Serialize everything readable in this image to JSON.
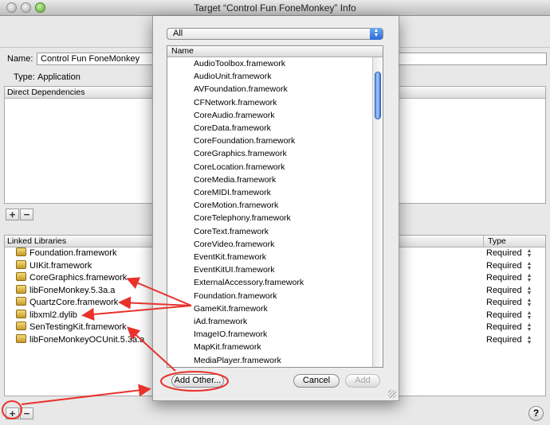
{
  "window": {
    "title": "Target “Control Fun FoneMonkey” Info"
  },
  "general": {
    "name_label": "Name:",
    "name_value": "Control Fun FoneMonkey",
    "type_label": "Type:",
    "type_value": "Application"
  },
  "direct_dependencies": {
    "header": "Direct Dependencies"
  },
  "linked_libraries": {
    "header": "Linked Libraries",
    "type_header": "Type",
    "items": [
      {
        "name": "Foundation.framework",
        "type": "Required"
      },
      {
        "name": "UIKit.framework",
        "type": "Required"
      },
      {
        "name": "CoreGraphics.framework",
        "type": "Required"
      },
      {
        "name": "libFoneMonkey.5.3a.a",
        "type": "Required"
      },
      {
        "name": "QuartzCore.framework",
        "type": "Required"
      },
      {
        "name": "libxml2.dylib",
        "type": "Required"
      },
      {
        "name": "SenTestingKit.framework",
        "type": "Required"
      },
      {
        "name": "libFoneMonkeyOCUnit.5.3a.a",
        "type": "Required"
      }
    ]
  },
  "buttons": {
    "add": "+",
    "remove": "−",
    "help": "?"
  },
  "sheet": {
    "filter_selected": "All",
    "column_header": "Name",
    "frameworks": [
      "AudioToolbox.framework",
      "AudioUnit.framework",
      "AVFoundation.framework",
      "CFNetwork.framework",
      "CoreAudio.framework",
      "CoreData.framework",
      "CoreFoundation.framework",
      "CoreGraphics.framework",
      "CoreLocation.framework",
      "CoreMedia.framework",
      "CoreMIDI.framework",
      "CoreMotion.framework",
      "CoreTelephony.framework",
      "CoreText.framework",
      "CoreVideo.framework",
      "EventKit.framework",
      "EventKitUI.framework",
      "ExternalAccessory.framework",
      "Foundation.framework",
      "GameKit.framework",
      "iAd.framework",
      "ImageIO.framework",
      "MapKit.framework",
      "MediaPlayer.framework"
    ],
    "add_other_label": "Add Other...",
    "cancel_label": "Cancel",
    "add_label": "Add"
  },
  "colors": {
    "annotation": "#e8322b",
    "accent": "#3a7bd8"
  }
}
